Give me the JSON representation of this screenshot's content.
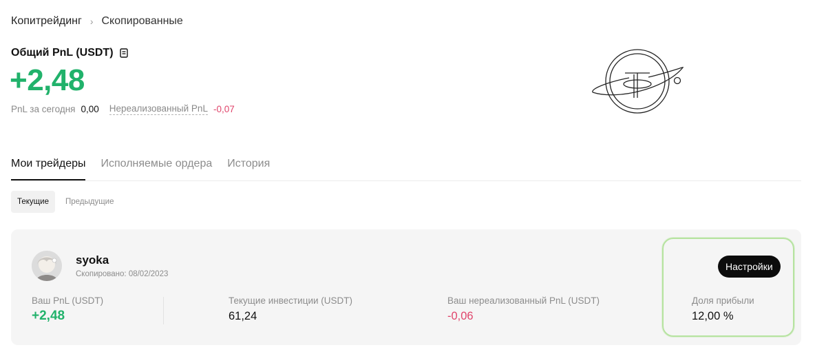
{
  "breadcrumb": {
    "root": "Копитрейдинг",
    "separator": "›",
    "current": "Скопированные"
  },
  "summary": {
    "title": "Общий PnL (USDT)",
    "title_icon": "document-icon",
    "total_pnl": "+2,48",
    "today_label": "PnL за сегодня",
    "today_value": "0,00",
    "unrealized_label": "Нереализованный PnL",
    "unrealized_value": "-0,07"
  },
  "tabs": [
    {
      "label": "Мои трейдеры",
      "active": true
    },
    {
      "label": "Исполняемые ордера",
      "active": false
    },
    {
      "label": "История",
      "active": false
    }
  ],
  "segments": [
    {
      "label": "Текущие",
      "active": true
    },
    {
      "label": "Предыдущие",
      "active": false
    }
  ],
  "trader": {
    "name": "syoka",
    "copied_label": "Скопировано: 08/02/2023",
    "settings_label": "Настройки",
    "stats": {
      "pnl_label": "Ваш PnL (USDT)",
      "pnl_value": "+2,48",
      "invest_label": "Текущие инвестиции (USDT)",
      "invest_value": "61,24",
      "unrealized_label": "Ваш нереализованный PnL (USDT)",
      "unrealized_value": "-0,06",
      "share_label": "Доля прибыли",
      "share_value": "12,00 %"
    }
  },
  "colors": {
    "positive": "#21b26b",
    "negative": "#e0456b",
    "highlight": "#b6e3a0"
  }
}
